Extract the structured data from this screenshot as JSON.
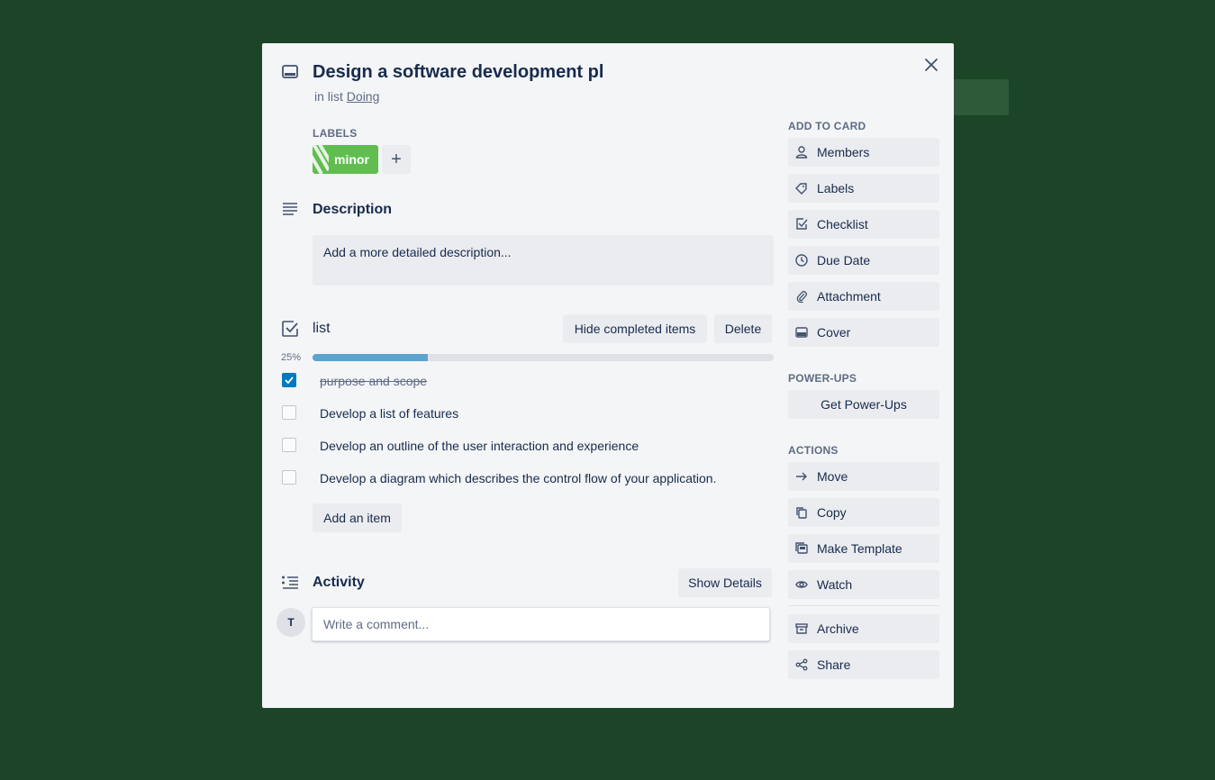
{
  "card": {
    "title": "Design a software development pl",
    "in_list_prefix": "in list",
    "list_name": "Doing"
  },
  "labels": {
    "heading": "LABELS",
    "items": [
      {
        "name": "minor",
        "color": "#61bd4f"
      }
    ],
    "add_symbol": "+"
  },
  "description": {
    "heading": "Description",
    "placeholder": "Add a more detailed description..."
  },
  "checklist": {
    "title": "list",
    "hide_button": "Hide completed items",
    "delete_button": "Delete",
    "progress_label": "25%",
    "progress_fraction": 0.25,
    "items": [
      {
        "text": "purpose and scope",
        "checked": true
      },
      {
        "text": "Develop a list of features",
        "checked": false
      },
      {
        "text": "Develop an outline of the user interaction and experience",
        "checked": false
      },
      {
        "text": "Develop a diagram which describes the control flow of your application.",
        "checked": false
      }
    ],
    "add_item_button": "Add an item"
  },
  "activity": {
    "heading": "Activity",
    "show_details_button": "Show Details",
    "avatar_initial": "T",
    "comment_placeholder": "Write a comment..."
  },
  "sidebar": {
    "add_to_card_heading": "ADD TO CARD",
    "add_to_card": [
      {
        "label": "Members",
        "icon": "person-icon"
      },
      {
        "label": "Labels",
        "icon": "tag-icon"
      },
      {
        "label": "Checklist",
        "icon": "checkbox-icon"
      },
      {
        "label": "Due Date",
        "icon": "clock-icon"
      },
      {
        "label": "Attachment",
        "icon": "paperclip-icon"
      },
      {
        "label": "Cover",
        "icon": "cover-icon"
      }
    ],
    "power_ups_heading": "POWER-UPS",
    "get_power_ups": "Get Power-Ups",
    "actions_heading": "ACTIONS",
    "actions": [
      {
        "label": "Move",
        "icon": "arrow-right-icon"
      },
      {
        "label": "Copy",
        "icon": "copy-icon"
      },
      {
        "label": "Make Template",
        "icon": "template-icon"
      },
      {
        "label": "Watch",
        "icon": "eye-icon"
      },
      {
        "label": "Archive",
        "icon": "archive-icon"
      },
      {
        "label": "Share",
        "icon": "share-icon"
      }
    ]
  },
  "colors": {
    "background": "#1b4526",
    "modal": "#f4f5f7",
    "progress_fill": "#5ba4cf",
    "checkbox_checked": "#0079bf"
  }
}
